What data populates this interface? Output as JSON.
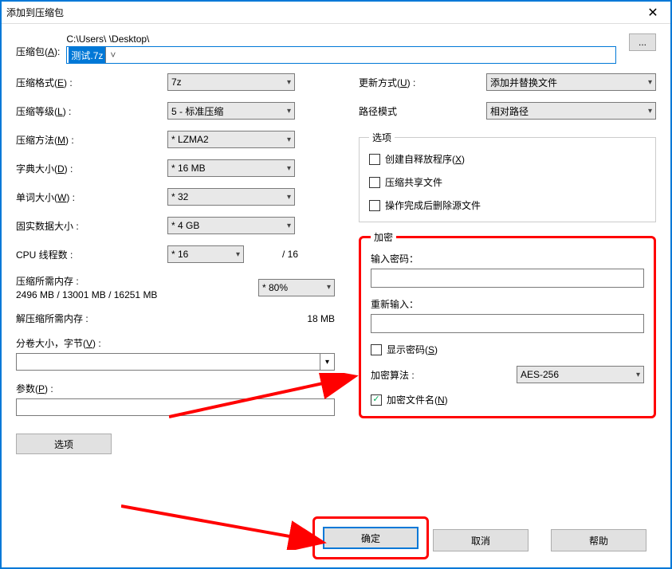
{
  "title": "添加到压缩包",
  "archive_label_pre": "压缩包(",
  "archive_label_u": "A",
  "archive_label_post": "):",
  "path": "C:\\Users\\        \\Desktop\\",
  "archive_name": "测试.7z",
  "browse": "...",
  "left": {
    "format_pre": "压缩格式(",
    "format_u": "E",
    "format_post": ") :",
    "format_val": "7z",
    "level_pre": "压缩等级(",
    "level_u": "L",
    "level_post": ") :",
    "level_val": "5 - 标准压缩",
    "method_pre": "压缩方法(",
    "method_u": "M",
    "method_post": ") :",
    "method_val": "* LZMA2",
    "dict_pre": "字典大小(",
    "dict_u": "D",
    "dict_post": ") :",
    "dict_val": "* 16 MB",
    "word_pre": "单词大小(",
    "word_u": "W",
    "word_post": ") :",
    "word_val": "* 32",
    "solid_label": "固实数据大小 :",
    "solid_val": "* 4 GB",
    "cpu_label": "CPU 线程数 :",
    "cpu_val": "* 16",
    "cpu_total": "/ 16",
    "mem_comp_label": "压缩所需内存 :",
    "mem_comp_val": "2496 MB / 13001 MB / 16251 MB",
    "mem_pct": "* 80%",
    "mem_decomp_label": "解压缩所需内存 :",
    "mem_decomp_val": "18 MB",
    "split_pre": "分卷大小，字节(",
    "split_u": "V",
    "split_post": ") :",
    "params_pre": "参数(",
    "params_u": "P",
    "params_post": ") :",
    "options_btn": "选项"
  },
  "right": {
    "update_pre": "更新方式(",
    "update_u": "U",
    "update_post": ") :",
    "update_val": "添加并替换文件",
    "pathmode_label": "路径模式",
    "pathmode_val": "相对路径",
    "opts_legend": "选项",
    "sfx_pre": "创建自释放程序(",
    "sfx_u": "X",
    "sfx_post": ")",
    "shared": "压缩共享文件",
    "delafter": "操作完成后删除源文件",
    "enc_legend": "加密",
    "pwd_label": "输入密码：",
    "pwd2_label": "重新输入：",
    "showpwd_pre": "显示密码(",
    "showpwd_u": "S",
    "showpwd_post": ")",
    "alg_label": "加密算法 :",
    "alg_val": "AES-256",
    "encnames_pre": "加密文件名(",
    "encnames_u": "N",
    "encnames_post": ")"
  },
  "btn_ok": "确定",
  "btn_cancel": "取消",
  "btn_help": "帮助"
}
